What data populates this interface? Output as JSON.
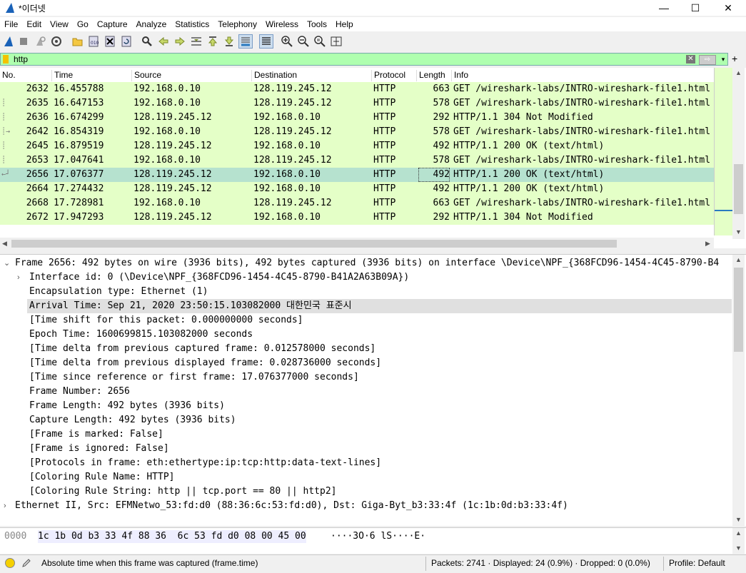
{
  "window": {
    "title": "*이더넷",
    "minimize": "—",
    "maximize": "☐",
    "close": "✕"
  },
  "menu": [
    "File",
    "Edit",
    "View",
    "Go",
    "Capture",
    "Analyze",
    "Statistics",
    "Telephony",
    "Wireless",
    "Tools",
    "Help"
  ],
  "filter": {
    "value": "http",
    "apply": "⇨",
    "dropdown": "▾",
    "add": "+"
  },
  "columns": [
    "No.",
    "Time",
    "Source",
    "Destination",
    "Protocol",
    "Length",
    "Info"
  ],
  "packets": [
    {
      "no": "2632",
      "time": "16.455788",
      "src": "192.168.0.10",
      "dst": "128.119.245.12",
      "proto": "HTTP",
      "len": "663",
      "info": "GET /wireshark-labs/INTRO-wireshark-file1.html"
    },
    {
      "no": "2635",
      "time": "16.647153",
      "src": "192.168.0.10",
      "dst": "128.119.245.12",
      "proto": "HTTP",
      "len": "578",
      "info": "GET /wireshark-labs/INTRO-wireshark-file1.html"
    },
    {
      "no": "2636",
      "time": "16.674299",
      "src": "128.119.245.12",
      "dst": "192.168.0.10",
      "proto": "HTTP",
      "len": "292",
      "info": "HTTP/1.1 304 Not Modified"
    },
    {
      "no": "2642",
      "time": "16.854319",
      "src": "192.168.0.10",
      "dst": "128.119.245.12",
      "proto": "HTTP",
      "len": "578",
      "info": "GET /wireshark-labs/INTRO-wireshark-file1.html"
    },
    {
      "no": "2645",
      "time": "16.879519",
      "src": "128.119.245.12",
      "dst": "192.168.0.10",
      "proto": "HTTP",
      "len": "492",
      "info": "HTTP/1.1 200 OK  (text/html)"
    },
    {
      "no": "2653",
      "time": "17.047641",
      "src": "192.168.0.10",
      "dst": "128.119.245.12",
      "proto": "HTTP",
      "len": "578",
      "info": "GET /wireshark-labs/INTRO-wireshark-file1.html"
    },
    {
      "no": "2656",
      "time": "17.076377",
      "src": "128.119.245.12",
      "dst": "192.168.0.10",
      "proto": "HTTP",
      "len": "492",
      "info": "HTTP/1.1 200 OK  (text/html)",
      "selected": true
    },
    {
      "no": "2664",
      "time": "17.274432",
      "src": "128.119.245.12",
      "dst": "192.168.0.10",
      "proto": "HTTP",
      "len": "492",
      "info": "HTTP/1.1 200 OK  (text/html)"
    },
    {
      "no": "2668",
      "time": "17.728981",
      "src": "192.168.0.10",
      "dst": "128.119.245.12",
      "proto": "HTTP",
      "len": "663",
      "info": "GET /wireshark-labs/INTRO-wireshark-file1.html"
    },
    {
      "no": "2672",
      "time": "17.947293",
      "src": "128.119.245.12",
      "dst": "192.168.0.10",
      "proto": "HTTP",
      "len": "292",
      "info": "HTTP/1.1 304 Not Modified"
    }
  ],
  "details": {
    "frame_header": "Frame 2656: 492 bytes on wire (3936 bits), 492 bytes captured (3936 bits) on interface \\Device\\NPF_{368FCD96-1454-4C45-8790-B4",
    "interface_id": "Interface id: 0 (\\Device\\NPF_{368FCD96-1454-4C45-8790-B41A2A63B09A})",
    "lines": [
      "Encapsulation type: Ethernet (1)",
      "Arrival Time: Sep 21, 2020 23:50:15.103082000 대한민국 표준시",
      "[Time shift for this packet: 0.000000000 seconds]",
      "Epoch Time: 1600699815.103082000 seconds",
      "[Time delta from previous captured frame: 0.012578000 seconds]",
      "[Time delta from previous displayed frame: 0.028736000 seconds]",
      "[Time since reference or first frame: 17.076377000 seconds]",
      "Frame Number: 2656",
      "Frame Length: 492 bytes (3936 bits)",
      "Capture Length: 492 bytes (3936 bits)",
      "[Frame is marked: False]",
      "[Frame is ignored: False]",
      "[Protocols in frame: eth:ethertype:ip:tcp:http:data-text-lines]",
      "[Coloring Rule Name: HTTP]",
      "[Coloring Rule String: http || tcp.port == 80 || http2]"
    ],
    "ethernet": "Ethernet II, Src: EFMNetwo_53:fd:d0 (88:36:6c:53:fd:d0), Dst: Giga-Byt_b3:33:4f (1c:1b:0d:b3:33:4f)"
  },
  "bytes": {
    "offset": "0000",
    "hex": "1c 1b 0d b3 33 4f 88 36  6c 53 fd d0 08 00 45 00",
    "ascii": "····3O·6 lS····E·"
  },
  "status": {
    "message": "Absolute time when this frame was captured (frame.time)",
    "counts": "Packets: 2741 · Displayed: 24 (0.9%) · Dropped: 0 (0.0%)",
    "profile": "Profile: Default"
  },
  "colors": {
    "http_row": "#e4ffc7",
    "selected_row": "#b6e2cf",
    "filter_ok": "#afffaf",
    "accent": "#2a7ac0"
  }
}
